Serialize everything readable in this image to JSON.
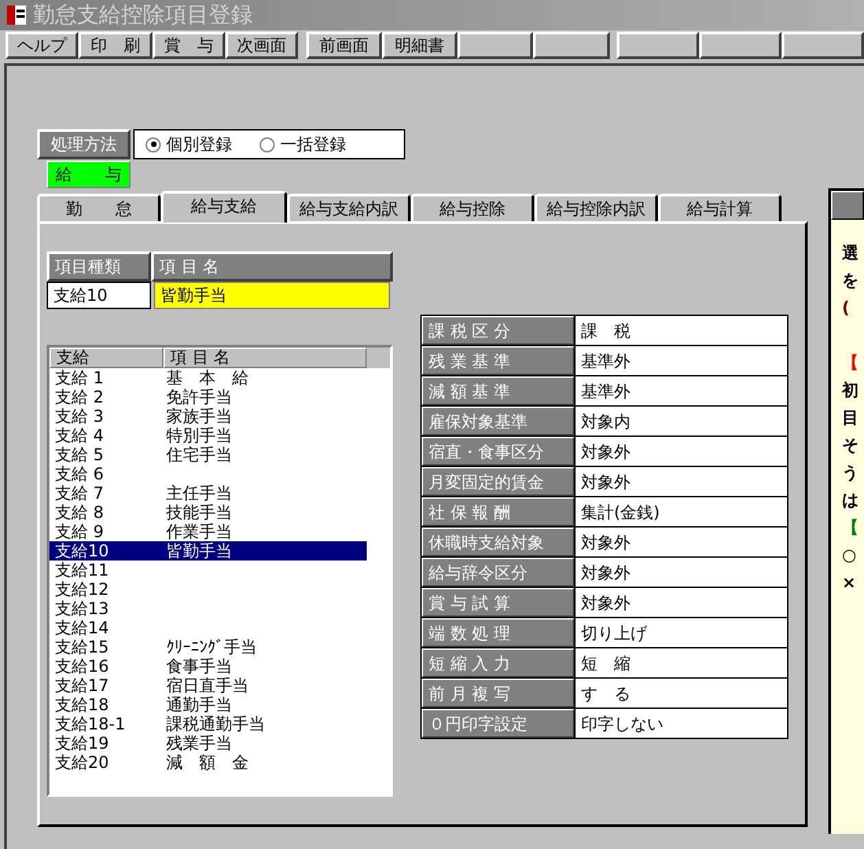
{
  "window": {
    "title": "勤怠支給控除項目登録"
  },
  "toolbar": [
    {
      "label": "ヘルプ"
    },
    {
      "label": "印　刷"
    },
    {
      "label": "賞　与"
    },
    {
      "label": "次画面"
    },
    {
      "label": "前画面"
    },
    {
      "label": "明細書"
    }
  ],
  "processing_method": {
    "label": "処理方法",
    "options": [
      {
        "label": "個別登録",
        "selected": true
      },
      {
        "label": "一括登録",
        "selected": false
      }
    ]
  },
  "category_badge": "給　　与",
  "tabs": [
    {
      "label": "勤　　怠",
      "selected": false
    },
    {
      "label": "給与支給",
      "selected": true
    },
    {
      "label": "給与支給内訳",
      "selected": false
    },
    {
      "label": "給与控除",
      "selected": false
    },
    {
      "label": "給与控除内訳",
      "selected": false
    },
    {
      "label": "給与計算",
      "selected": false
    }
  ],
  "item_header": {
    "columns": [
      "項目種類",
      "項 目 名"
    ],
    "kind": "支給10",
    "name": "皆勤手当"
  },
  "list": {
    "columns": [
      "支給",
      "項 目 名"
    ],
    "rows": [
      {
        "code": "支給 1",
        "name": "基　本　給",
        "selected": false
      },
      {
        "code": "支給 2",
        "name": "免許手当",
        "selected": false
      },
      {
        "code": "支給 3",
        "name": "家族手当",
        "selected": false
      },
      {
        "code": "支給 4",
        "name": "特別手当",
        "selected": false
      },
      {
        "code": "支給 5",
        "name": "住宅手当",
        "selected": false
      },
      {
        "code": "支給 6",
        "selected": false
      },
      {
        "code": "支給 7",
        "name": "主任手当",
        "selected": false
      },
      {
        "code": "支給 8",
        "name": "技能手当",
        "selected": false
      },
      {
        "code": "支給 9",
        "name": "作業手当",
        "selected": false
      },
      {
        "code": "支給10",
        "name": "皆勤手当",
        "selected": true
      },
      {
        "code": "支給11",
        "selected": false
      },
      {
        "code": "支給12",
        "selected": false
      },
      {
        "code": "支給13",
        "selected": false
      },
      {
        "code": "支給14",
        "selected": false
      },
      {
        "code": "支給15",
        "name": "ｸﾘｰﾆﾝｸﾞ手当",
        "selected": false
      },
      {
        "code": "支給16",
        "name": "食事手当",
        "selected": false
      },
      {
        "code": "支給17",
        "name": "宿日直手当",
        "selected": false
      },
      {
        "code": "支給18",
        "name": "通勤手当",
        "selected": false
      },
      {
        "code": "支給18-1",
        "name": "課税通勤手当",
        "selected": false
      },
      {
        "code": "支給19",
        "name": "残業手当",
        "selected": false
      },
      {
        "code": "支給20",
        "name": "減　額　金",
        "selected": false
      }
    ]
  },
  "attributes": [
    {
      "label": "課 税 区 分",
      "value": "課　税"
    },
    {
      "label": "残 業 基 準",
      "value": "基準外"
    },
    {
      "label": "減 額 基 準",
      "value": "基準外"
    },
    {
      "label": "雇保対象基準",
      "value": "対象内"
    },
    {
      "label": "宿直・食事区分",
      "value": "対象外"
    },
    {
      "label": "月変固定的賃金",
      "value": "対象外"
    },
    {
      "label": "社 保 報 酬",
      "value": "集計(金銭)"
    },
    {
      "label": "休職時支給対象",
      "value": "対象外"
    },
    {
      "label": "給与辞令区分",
      "value": "対象外"
    },
    {
      "label": "賞 与 試 算",
      "value": "対象外"
    },
    {
      "label": "端 数 処 理",
      "value": "切り上げ"
    },
    {
      "label": "短 縮 入 力",
      "value": "短　縮"
    },
    {
      "label": "前 月 複 写",
      "value": "す　る"
    },
    {
      "label": "０円印字設定",
      "value": "印字しない"
    }
  ],
  "help_panel": {
    "lines": [
      {
        "text": "選",
        "color": "#000000"
      },
      {
        "text": "を",
        "color": "#000000"
      },
      {
        "text": "(",
        "color": "#800000"
      },
      {
        "text": "【",
        "color": "#ff0000",
        "gap_before": true
      },
      {
        "text": "初",
        "color": "#000000"
      },
      {
        "text": "目",
        "color": "#000000"
      },
      {
        "text": "そ",
        "color": "#000000"
      },
      {
        "text": "う",
        "color": "#000000"
      },
      {
        "text": "は",
        "color": "#000000"
      },
      {
        "text": "【",
        "color": "#008000"
      },
      {
        "text": "○",
        "color": "#000000"
      },
      {
        "text": "×",
        "color": "#000000"
      }
    ]
  }
}
